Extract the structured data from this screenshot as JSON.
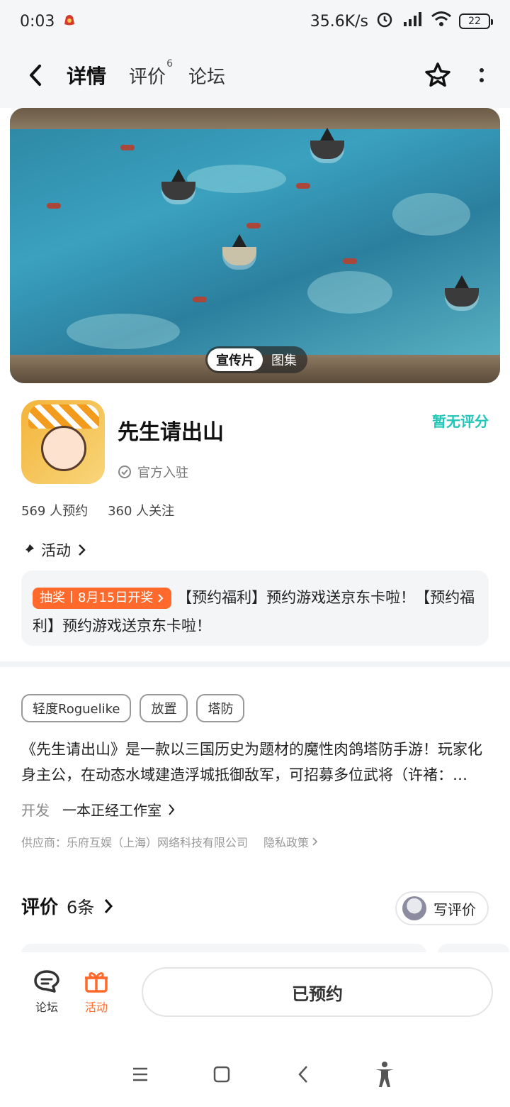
{
  "status_bar": {
    "time": "0:03",
    "speed": "35.6K/s",
    "battery": "22"
  },
  "header": {
    "tabs": [
      {
        "label": "详情",
        "active": true
      },
      {
        "label": "评价",
        "badge": "6"
      },
      {
        "label": "论坛"
      }
    ]
  },
  "banner": {
    "options": [
      "宣传片",
      "图集"
    ],
    "active_option": "宣传片"
  },
  "app": {
    "name": "先生请出山",
    "official_label": "官方入驻",
    "rating_status": "暂无评分",
    "reservations": "569 人预约",
    "followers": "360 人关注"
  },
  "activity": {
    "section_label": "活动",
    "badge_label": "抽奖丨8月15日开奖",
    "text": "【预约福利】预约游戏送京东卡啦！【预约福利】预约游戏送京东卡啦！"
  },
  "tags": [
    "轻度Roguelike",
    "放置",
    "塔防"
  ],
  "description": "《先生请出山》是一款以三国历史为题材的魔性肉鸽塔防手游！玩家化身主公，在动态水域建造浮城抵御敌军，可招募多位武将（许褚：…",
  "developer": {
    "label": "开发",
    "name": "一本正经工作室"
  },
  "supplier": {
    "text": "供应商：乐府互娱（上海）网络科技有限公司",
    "privacy_label": "隐私政策"
  },
  "reviews": {
    "title": "评价",
    "count": "6条",
    "write_label": "写评价"
  },
  "bottom_bar": {
    "forum_label": "论坛",
    "activity_label": "活动",
    "reserved_label": "已预约"
  },
  "colors": {
    "accent": "#20c7b8",
    "orange": "#ff6a2c"
  }
}
